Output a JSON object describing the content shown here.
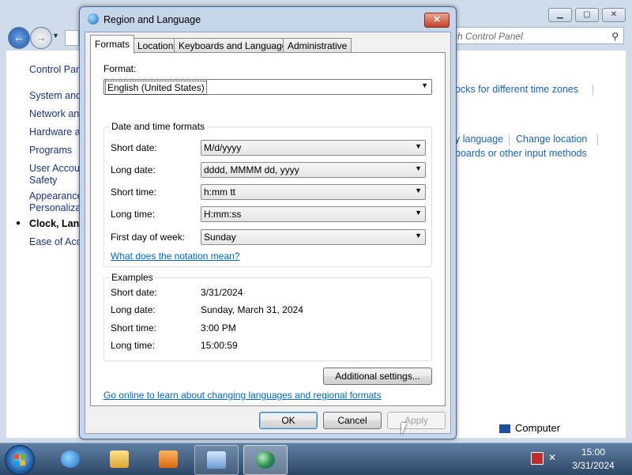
{
  "control_panel": {
    "search_placeholder": "rch Control Panel",
    "sidebar": [
      {
        "label": "Control Panel Home"
      },
      {
        "label": "System and Security"
      },
      {
        "label": "Network and Internet"
      },
      {
        "label": "Hardware and Sound"
      },
      {
        "label": "Programs"
      },
      {
        "label": "User Accounts and"
      },
      {
        "label": "Safety"
      },
      {
        "label": "Appearance and"
      },
      {
        "label": "Personalization"
      },
      {
        "label": "Clock, Language, and Region"
      },
      {
        "label": "Ease of Access"
      }
    ],
    "links": {
      "clocks": "ocks for different time zones",
      "display_language": "y language",
      "change_location": "Change location",
      "keyboards": "boards or other input methods"
    },
    "computer_label": "Computer"
  },
  "dialog": {
    "title": "Region and Language",
    "close_glyph": "✕",
    "tabs": [
      "Formats",
      "Location",
      "Keyboards and Languages",
      "Administrative"
    ],
    "format_label": "Format:",
    "format_value": "English (United States)",
    "date_time_group": "Date and time formats",
    "fields": [
      {
        "label": "Short date:",
        "value": "M/d/yyyy"
      },
      {
        "label": "Long date:",
        "value": "dddd, MMMM dd, yyyy"
      },
      {
        "label": "Short time:",
        "value": "h:mm tt"
      },
      {
        "label": "Long time:",
        "value": "H:mm:ss"
      },
      {
        "label": "First day of week:",
        "value": "Sunday"
      }
    ],
    "notation_link": "What does the notation mean?",
    "examples_group": "Examples",
    "examples": [
      {
        "label": "Short date:",
        "value": "3/31/2024"
      },
      {
        "label": "Long date:",
        "value": "Sunday, March 31, 2024"
      },
      {
        "label": "Short time:",
        "value": "3:00 PM"
      },
      {
        "label": "Long time:",
        "value": "15:00:59"
      }
    ],
    "additional_settings": "Additional settings...",
    "online_link": "Go online to learn about changing languages and regional formats",
    "ok": "OK",
    "cancel": "Cancel",
    "apply": "Apply"
  },
  "taskbar": {
    "time": "15:00",
    "date": "3/31/2024"
  }
}
